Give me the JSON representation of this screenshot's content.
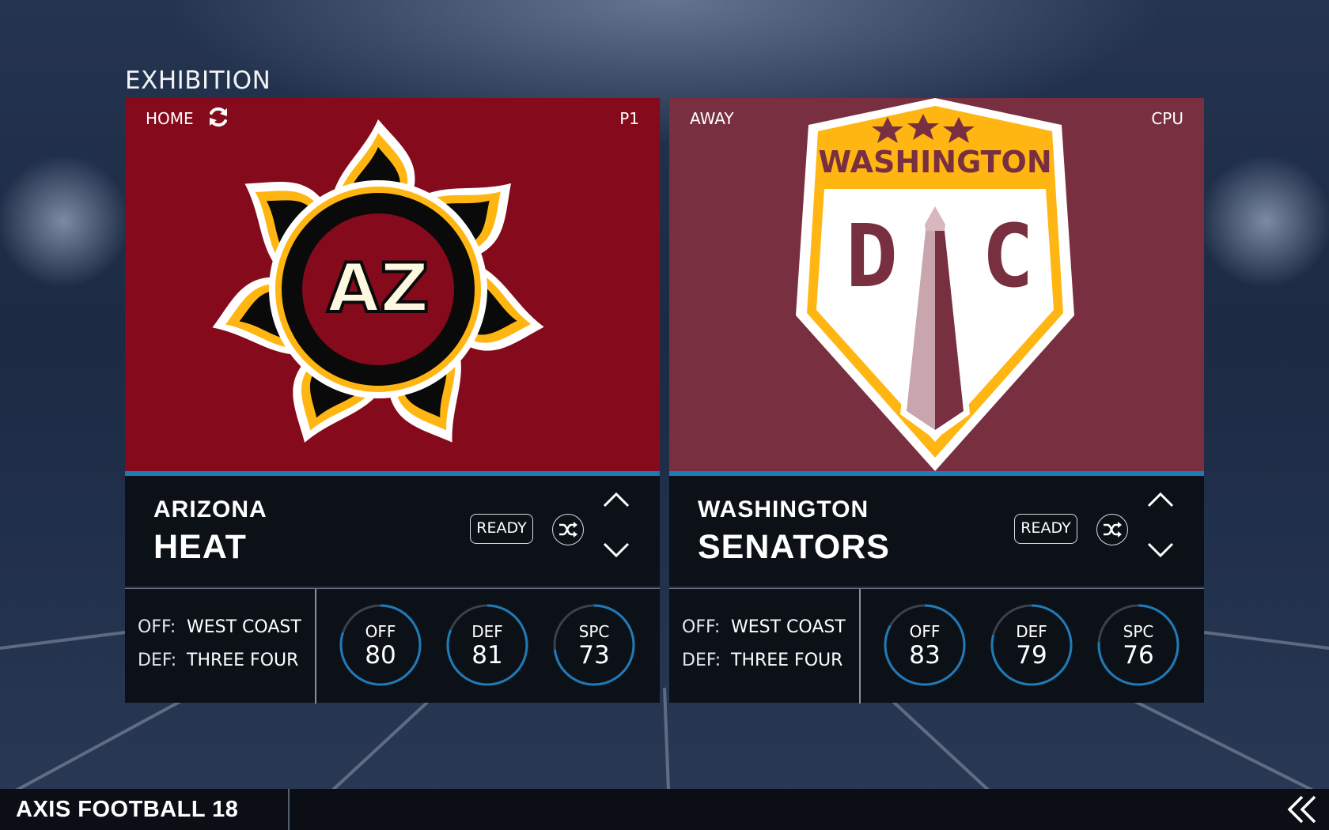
{
  "screen": {
    "title": "EXHIBITION"
  },
  "home": {
    "side_label": "HOME",
    "controller": "P1",
    "city": "ARIZONA",
    "name": "HEAT",
    "panel_color": "#850a1b",
    "logo_text": "AZ",
    "ready_label": "READY",
    "offense_key": "OFF:",
    "offense_scheme": "WEST COAST",
    "defense_key": "DEF:",
    "defense_scheme": "THREE FOUR",
    "ratings": [
      {
        "label": "OFF",
        "value": 80
      },
      {
        "label": "DEF",
        "value": 81
      },
      {
        "label": "SPC",
        "value": 73
      }
    ]
  },
  "away": {
    "side_label": "AWAY",
    "controller": "CPU",
    "city": "WASHINGTON",
    "name": "SENATORS",
    "panel_color": "#782f40",
    "logo_banner": "WASHINGTON",
    "logo_left_letter": "D",
    "logo_right_letter": "C",
    "ready_label": "READY",
    "offense_key": "OFF:",
    "offense_scheme": "WEST COAST",
    "defense_key": "DEF:",
    "defense_scheme": "THREE FOUR",
    "ratings": [
      {
        "label": "OFF",
        "value": 83
      },
      {
        "label": "DEF",
        "value": 79
      },
      {
        "label": "SPC",
        "value": 76
      }
    ]
  },
  "footer": {
    "game_title": "AXIS FOOTBALL 18"
  },
  "colors": {
    "accent": "#1f7ab8",
    "ring_track": "#3a414c",
    "gold": "#ffb612"
  },
  "icons": {
    "swap": "refresh-icon",
    "shuffle": "shuffle-icon",
    "up": "chevron-up-icon",
    "down": "chevron-down-icon",
    "back": "double-chevron-left-icon"
  }
}
